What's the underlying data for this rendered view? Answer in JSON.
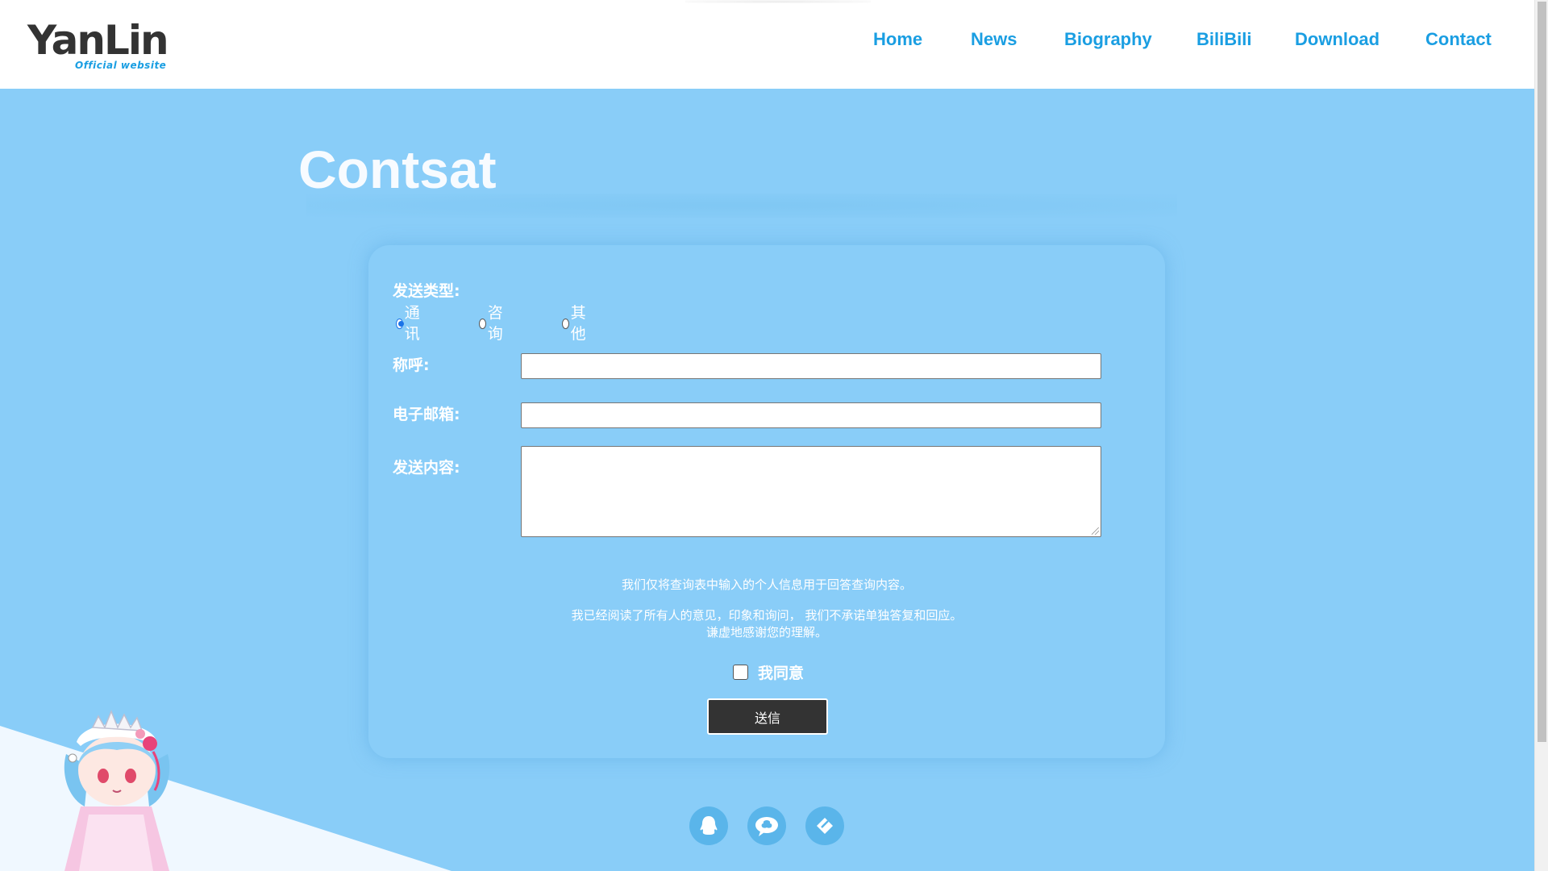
{
  "logo": {
    "main": "YanLin",
    "sub": "Official website"
  },
  "nav": {
    "items": [
      {
        "label": "Home"
      },
      {
        "label": "News"
      },
      {
        "label": "Biography"
      },
      {
        "label": "BiliBili"
      },
      {
        "label": "Download"
      },
      {
        "label": "Contact"
      }
    ]
  },
  "page": {
    "title": "Contsat"
  },
  "form": {
    "send_type_label": "发送类型:",
    "radio_options": [
      {
        "label": "通讯",
        "checked": true
      },
      {
        "label": "咨询",
        "checked": false
      },
      {
        "label": "其他",
        "checked": false
      }
    ],
    "name_label": "称呼:",
    "name_value": "",
    "email_label": "电子邮箱:",
    "email_value": "",
    "content_label": "发送内容:",
    "content_value": "",
    "note1": "我们仅将查询表中输入的个人信息用于回答查询内容。",
    "note2": "我已经阅读了所有人的意见，印象和询问， 我们不承诺单独答复和回应。 谦虚地感谢您的理解。",
    "agree_label": "我同意",
    "agree_checked": false,
    "submit_label": "送信"
  },
  "social": [
    {
      "icon": "qq-icon"
    },
    {
      "icon": "wechat-icon"
    },
    {
      "icon": "weibo-icon"
    }
  ],
  "colors": {
    "accent": "#1a9ee2",
    "background": "#89cdf8",
    "button": "#333333",
    "social": "#5ab5ea"
  }
}
